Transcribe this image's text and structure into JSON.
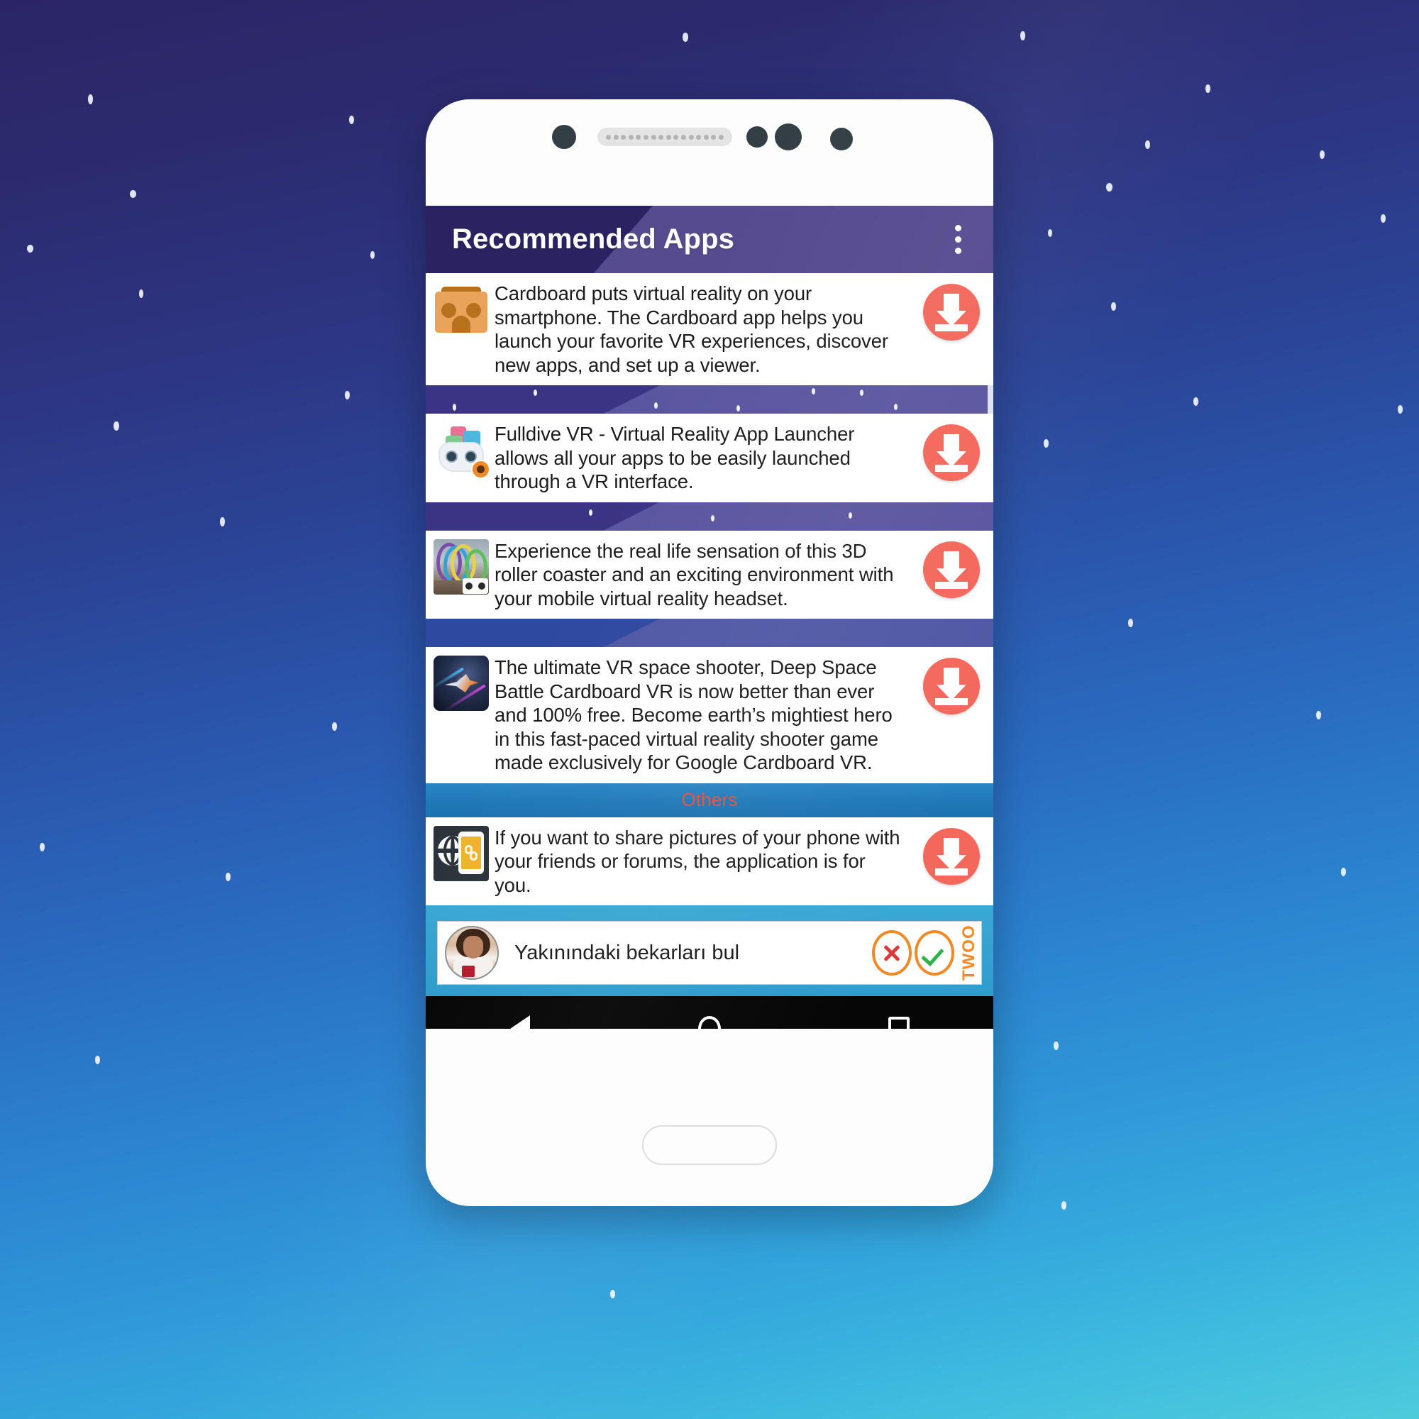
{
  "app": {
    "title": "Recommended Apps",
    "overflow_icon": "more-vertical-icon",
    "appbar_color": "#564b8e",
    "appbar_dark_color": "#2b2262"
  },
  "apps": [
    {
      "icon": "google-cardboard-icon",
      "description": "Cardboard puts virtual reality on your smartphone. The Cardboard app helps you launch your favorite VR experiences, discover new apps, and set up a viewer.",
      "action_icon": "download-icon"
    },
    {
      "icon": "fulldive-vr-headset-icon",
      "description": "Fulldive VR - Virtual Reality App Launcher allows all your apps to be easily launched through a VR interface.",
      "action_icon": "download-icon"
    },
    {
      "icon": "roller-coaster-vr-icon",
      "description": "Experience the real life sensation of this 3D roller coaster and an exciting environment with your mobile virtual reality headset.",
      "action_icon": "download-icon"
    },
    {
      "icon": "deep-space-battle-icon",
      "description": "The ultimate VR space shooter, Deep Space Battle Cardboard VR is now better than ever and 100% free. Become earth’s mightiest hero in this fast-paced virtual reality shooter game made exclusively for Google Cardboard VR.",
      "action_icon": "download-icon"
    }
  ],
  "others_section": {
    "label": "Others",
    "label_color": "#e8503a",
    "band_color": "#2079b8",
    "apps": [
      {
        "icon": "link-share-icon",
        "description": "If you want to share pictures of your phone with your friends or forums, the application is for you.",
        "action_icon": "download-icon"
      }
    ]
  },
  "ad": {
    "text": "Yakınındaki bekarları bul",
    "brand": "TWOO",
    "brand_color": "#f08a26",
    "reject_icon": "x-icon",
    "accept_icon": "check-icon",
    "avatar": "ad-avatar-photo"
  },
  "navbar": {
    "back": "back-triangle-icon",
    "home": "home-circle-icon",
    "recents": "recents-square-icon"
  },
  "download_button_color": "#f4685c"
}
